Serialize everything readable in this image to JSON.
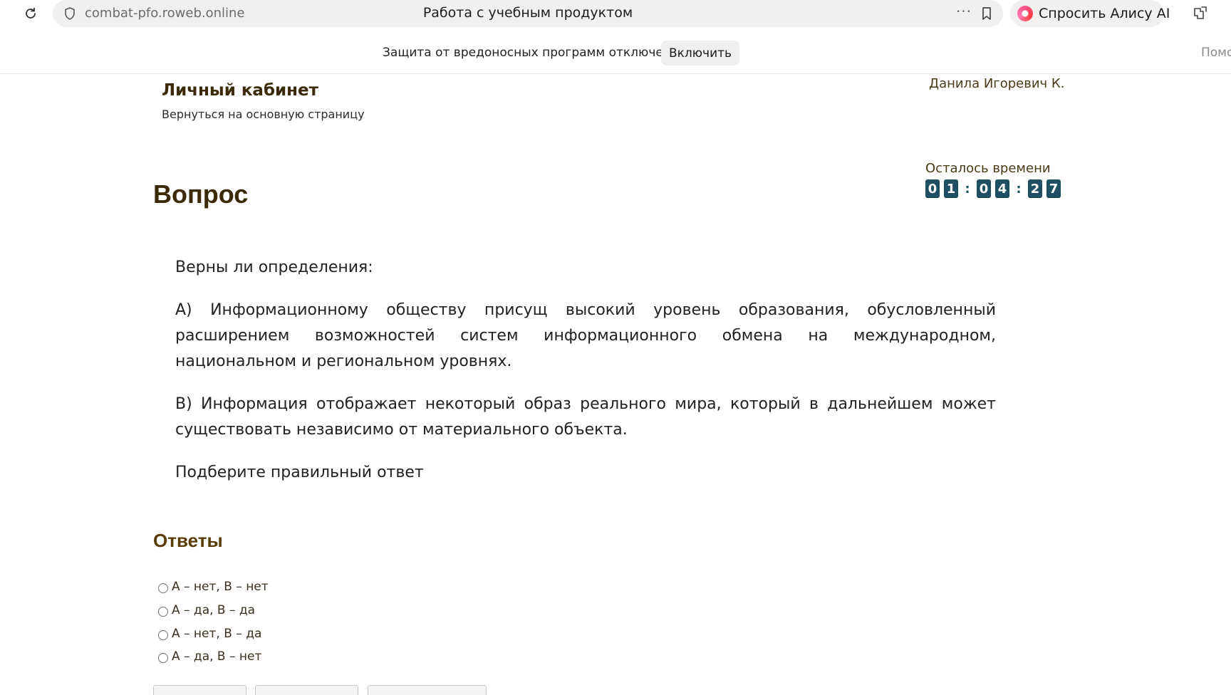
{
  "browser": {
    "url": "combat-pfo.roweb.online",
    "tab_title": "Работа с учебным продуктом",
    "more_glyph": "···",
    "alice_label": "Спросить Алису AI"
  },
  "notification": {
    "text": "Защита от вредоносных программ отключена",
    "enable_label": "Включить",
    "help_label": "Помо"
  },
  "header": {
    "cabinet_title": "Личный кабинет",
    "back_link": "Вернуться на основную страницу",
    "user_name": "Данила Игоревич К."
  },
  "timer": {
    "label": "Осталось времени",
    "hours": [
      "0",
      "1"
    ],
    "minutes": [
      "0",
      "4"
    ],
    "seconds": [
      "2",
      "7"
    ],
    "separator": ":"
  },
  "question": {
    "heading": "Вопрос",
    "paragraphs": [
      "Верны ли определения:",
      "А) Информационному обществу присущ высокий уровень образования, обусловленный расширением возможностей систем информационного обмена на международном, национальном и региональном уровнях.",
      "В) Информация отображает некоторый образ реального мира, который в дальнейшем может существовать независимо от материального объекта.",
      "Подберите правильный ответ"
    ]
  },
  "answers": {
    "heading": "Ответы",
    "options": [
      "А – нет, В – нет",
      "А – да, В – да",
      "А – нет, В – да",
      "А – да, В – нет"
    ]
  },
  "colors": {
    "heading_brown": "#3b2a05",
    "timer_digit_bg": "#1f4f63"
  }
}
